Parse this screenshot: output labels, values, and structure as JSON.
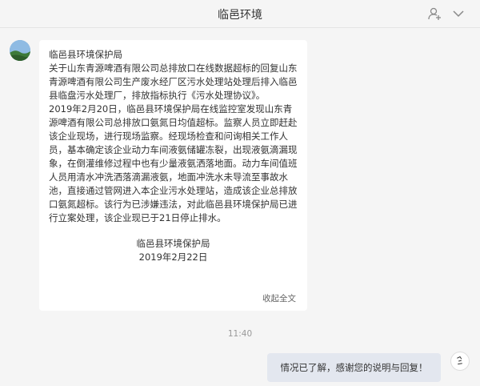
{
  "window": {
    "title": "临邑环境",
    "icons": [
      "add-user-icon",
      "chevron-down-icon"
    ]
  },
  "messages": {
    "incoming": {
      "sender": "临邑县环境保护局",
      "paragraph1": "关于山东青源啤酒有限公司总排放口在线数据超标的回复山东青源啤酒有限公司生产废水经厂区污水处理站处理后排入临邑县临盘污水处理厂，排放指标执行《污水处理协议》。",
      "paragraph2": "2019年2月20日，临邑县环境保护局在线监控室发现山东青源啤酒有限公司总排放口氨氮日均值超标。监察人员立即赶赴该企业现场，进行现场监察。经现场检查和问询相关工作人员，基本确定该企业动力车间液氨储罐冻裂，出现液氨滴漏现象，在倒灌维修过程中也有少量液氨洒落地面。动力车间值班人员用清水冲洗洒落滴漏液氨，地面冲洗水未导流至事故水池，直接通过管网进入本企业污水处理站，造成该企业总排放口氨氮超标。该行为已涉嫌违法，对此临邑县环境保护局已进行立案处理，该企业现已于21日停止排水。",
      "signature_org": "临邑县环境保护局",
      "signature_date": "2019年2月22日",
      "collapse_label": "收起全文"
    },
    "time": "11:40",
    "outgoing": {
      "text": "情况已了解，感谢您的说明与回复！"
    }
  }
}
